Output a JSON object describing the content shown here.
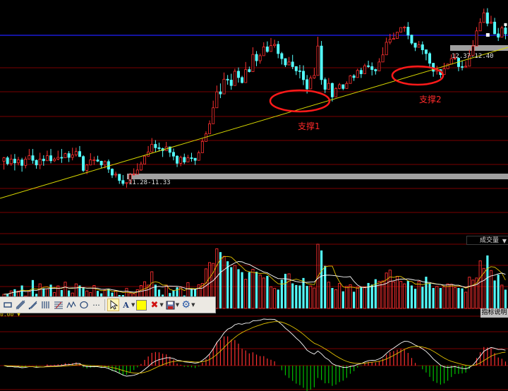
{
  "chart_data": {
    "type": "candlestick",
    "candles": [
      [
        44.0,
        44.8,
        42.0,
        45.0
      ],
      [
        44.8,
        43.4,
        43.0,
        45.2
      ],
      [
        43.4,
        44.5,
        42.9,
        45.6
      ],
      [
        44.5,
        43.6,
        41.8,
        45.7
      ],
      [
        43.6,
        44.3,
        43.0,
        45.0
      ],
      [
        44.3,
        43.0,
        41.5,
        44.8
      ],
      [
        43.0,
        44.5,
        42.3,
        45.1
      ],
      [
        44.5,
        45.3,
        44.7,
        46.9
      ],
      [
        45.3,
        44.2,
        43.4,
        46.9
      ],
      [
        44.2,
        43.1,
        42.2,
        44.4
      ],
      [
        43.1,
        44.5,
        42.1,
        46.0
      ],
      [
        44.5,
        44.1,
        42.9,
        45.4
      ],
      [
        44.1,
        45.3,
        44.3,
        46.5
      ],
      [
        45.3,
        44.1,
        43.5,
        46.9
      ],
      [
        44.1,
        44.5,
        43.8,
        44.9
      ],
      [
        44.5,
        44.9,
        44.2,
        46.5
      ],
      [
        44.9,
        44.8,
        43.6,
        46.9
      ],
      [
        44.8,
        45.8,
        45.4,
        46.0
      ],
      [
        45.8,
        44.9,
        43.8,
        46.4
      ],
      [
        44.9,
        45.5,
        44.2,
        47.2
      ],
      [
        45.5,
        46.3,
        45.1,
        47.2
      ],
      [
        46.3,
        45.1,
        45.0,
        47.6
      ],
      [
        45.1,
        41.8,
        41.4,
        45.4
      ],
      [
        41.8,
        43.1,
        40.9,
        43.3
      ],
      [
        43.1,
        44.3,
        43.0,
        45.9
      ],
      [
        44.3,
        44.3,
        43.1,
        45.1
      ],
      [
        44.3,
        44.0,
        43.8,
        45.3
      ],
      [
        44.0,
        43.1,
        42.4,
        44.1
      ],
      [
        43.1,
        43.9,
        42.3,
        44.2
      ],
      [
        43.9,
        42.1,
        41.2,
        44.4
      ],
      [
        42.1,
        40.7,
        40.0,
        42.3
      ],
      [
        40.7,
        40.9,
        40.1,
        41.5
      ],
      [
        40.9,
        39.4,
        38.6,
        40.9
      ],
      [
        39.4,
        38.7,
        38.2,
        40.7
      ],
      [
        38.7,
        38.9,
        37.7,
        38.9
      ],
      [
        38.9,
        40.8,
        39.6,
        41.2
      ],
      [
        40.8,
        40.9,
        40.6,
        42.3
      ],
      [
        40.9,
        41.9,
        41.1,
        43.5
      ],
      [
        41.9,
        43.3,
        41.7,
        43.9
      ],
      [
        43.3,
        45.2,
        44.9,
        45.5
      ],
      [
        45.2,
        46.2,
        45.1,
        47.6
      ],
      [
        46.2,
        48.0,
        46.7,
        49.5
      ],
      [
        48.0,
        47.2,
        46.1,
        49.0
      ],
      [
        47.2,
        47.0,
        46.3,
        48.4
      ],
      [
        47.0,
        46.5,
        45.0,
        47.2
      ],
      [
        46.5,
        47.4,
        46.9,
        48.6
      ],
      [
        47.4,
        46.1,
        45.0,
        47.4
      ],
      [
        46.1,
        45.2,
        44.2,
        47.0
      ],
      [
        45.2,
        43.5,
        42.6,
        45.4
      ],
      [
        43.5,
        44.9,
        42.8,
        45.3
      ],
      [
        44.9,
        43.8,
        43.3,
        45.8
      ],
      [
        43.8,
        44.8,
        44.6,
        45.5
      ],
      [
        44.8,
        44.7,
        43.9,
        46.0
      ],
      [
        44.7,
        44.2,
        43.1,
        44.7
      ],
      [
        44.2,
        46.0,
        45.7,
        46.5
      ],
      [
        46.0,
        48.7,
        47.6,
        49.4
      ],
      [
        48.7,
        50.5,
        50.1,
        51.1
      ],
      [
        50.5,
        52.9,
        51.8,
        53.7
      ],
      [
        52.9,
        56.7,
        55.3,
        58.4
      ],
      [
        56.7,
        60.5,
        59.7,
        62.0
      ],
      [
        60.5,
        60.0,
        59.0,
        62.5
      ],
      [
        60.0,
        63.5,
        62.6,
        65.1
      ],
      [
        63.5,
        63.3,
        62.2,
        64.5
      ],
      [
        63.3,
        62.0,
        61.0,
        64.8
      ],
      [
        62.0,
        65.4,
        64.9,
        66.0
      ],
      [
        65.4,
        63.9,
        62.7,
        66.3
      ],
      [
        63.9,
        62.7,
        62.5,
        64.3
      ],
      [
        62.7,
        65.8,
        64.3,
        67.6
      ],
      [
        65.8,
        65.3,
        65.1,
        66.5
      ],
      [
        65.3,
        69.4,
        67.8,
        71.1
      ],
      [
        69.4,
        67.9,
        66.6,
        70.2
      ],
      [
        67.9,
        69.1,
        67.2,
        69.6
      ],
      [
        69.1,
        71.2,
        70.9,
        72.3
      ],
      [
        71.2,
        70.1,
        69.8,
        72.5
      ],
      [
        70.1,
        71.5,
        71.1,
        73.3
      ],
      [
        71.5,
        71.8,
        71.0,
        72.9
      ],
      [
        71.8,
        69.6,
        68.5,
        72.6
      ],
      [
        69.6,
        68.4,
        67.0,
        70.0
      ],
      [
        68.4,
        66.9,
        66.4,
        68.5
      ],
      [
        66.9,
        67.6,
        67.4,
        68.8
      ],
      [
        67.6,
        66.5,
        65.9,
        69.3
      ],
      [
        66.5,
        65.5,
        64.5,
        66.6
      ],
      [
        65.5,
        65.4,
        63.7,
        66.9
      ],
      [
        65.4,
        63.4,
        62.1,
        66.8
      ],
      [
        63.4,
        61.2,
        60.1,
        64.5
      ],
      [
        61.2,
        63.8,
        63.4,
        64.4
      ],
      [
        63.8,
        64.4,
        63.6,
        66.2
      ],
      [
        64.4,
        71.4,
        69.8,
        73.6
      ],
      [
        71.4,
        63.4,
        62.2,
        72.6
      ],
      [
        63.4,
        61.1,
        60.2,
        63.9
      ],
      [
        61.1,
        62.5,
        61.2,
        63.8
      ],
      [
        62.5,
        59.3,
        58.2,
        62.7
      ],
      [
        59.3,
        61.3,
        59.6,
        61.6
      ],
      [
        61.3,
        62.2,
        61.1,
        62.6
      ],
      [
        62.2,
        61.3,
        60.9,
        62.2
      ],
      [
        61.3,
        62.5,
        61.4,
        63.0
      ],
      [
        62.5,
        64.3,
        64.0,
        64.5
      ],
      [
        64.3,
        63.9,
        63.1,
        64.7
      ],
      [
        63.9,
        65.6,
        64.8,
        66.0
      ],
      [
        65.6,
        64.8,
        63.8,
        66.2
      ],
      [
        64.8,
        66.7,
        66.4,
        67.2
      ],
      [
        66.7,
        66.5,
        66.2,
        67.9
      ],
      [
        66.5,
        65.8,
        64.4,
        67.5
      ],
      [
        65.8,
        65.5,
        64.6,
        66.0
      ],
      [
        65.5,
        67.6,
        67.2,
        68.5
      ],
      [
        67.6,
        69.3,
        68.4,
        71.1
      ],
      [
        69.3,
        72.3,
        70.8,
        73.4
      ],
      [
        72.3,
        73.0,
        71.8,
        74.3
      ],
      [
        73.0,
        73.2,
        73.3,
        74.6
      ],
      [
        73.2,
        74.7,
        73.6,
        74.6
      ],
      [
        74.7,
        75.8,
        75.1,
        75.7
      ],
      [
        75.8,
        75.9,
        74.8,
        76.2
      ],
      [
        75.9,
        74.0,
        73.0,
        77.1
      ],
      [
        74.0,
        72.1,
        71.7,
        74.1
      ],
      [
        72.1,
        71.1,
        70.2,
        71.3
      ],
      [
        71.1,
        71.7,
        71.2,
        72.6
      ],
      [
        71.7,
        70.5,
        69.4,
        72.5
      ],
      [
        70.5,
        69.6,
        68.0,
        70.5
      ],
      [
        69.6,
        67.3,
        66.1,
        70.0
      ],
      [
        67.3,
        65.4,
        64.1,
        67.4
      ],
      [
        65.4,
        65.8,
        64.6,
        66.7
      ],
      [
        65.8,
        64.6,
        63.8,
        65.9
      ],
      [
        64.6,
        66.0,
        65.3,
        67.4
      ],
      [
        66.0,
        67.1,
        66.3,
        67.2
      ],
      [
        67.1,
        68.4,
        67.0,
        69.4
      ],
      [
        68.4,
        68.5,
        68.1,
        69.6
      ],
      [
        68.5,
        66.5,
        65.4,
        68.7
      ],
      [
        66.5,
        66.4,
        65.6,
        68.0
      ],
      [
        66.4,
        66.6,
        66.4,
        67.8
      ],
      [
        66.6,
        69.2,
        68.5,
        70.5
      ],
      [
        69.2,
        71.4,
        69.9,
        72.8
      ],
      [
        71.4,
        75.0,
        74.9,
        75.9
      ],
      [
        75.0,
        77.0,
        75.2,
        78.0
      ],
      [
        77.0,
        79.3,
        78.1,
        80.3
      ],
      [
        79.3,
        76.8,
        76.1,
        80.4
      ],
      [
        76.8,
        77.1,
        76.7,
        78.6
      ],
      [
        77.1,
        74.3,
        74.2,
        78.1
      ],
      [
        74.3,
        73.5,
        72.6,
        75.7
      ],
      [
        73.5,
        75.7,
        75.3,
        76.2
      ],
      [
        75.7,
        74.3,
        73.0,
        76.5
      ]
    ],
    "value_axis": "unlabeled price scale",
    "volume": [
      [
        3.4,
        0.11
      ],
      [
        3.5,
        0.42
      ],
      [
        4.2,
        0.83
      ],
      [
        4.6,
        0.92
      ],
      [
        4.2,
        0.72
      ],
      [
        5.5,
        0.44
      ],
      [
        3.0,
        0.62
      ],
      [
        4.3,
        0.95
      ],
      [
        6.8,
        0.42
      ],
      [
        3.5,
        0.21
      ],
      [
        5.9,
        0.32
      ],
      [
        4.8,
        0.64
      ],
      [
        4.7,
        0.53
      ],
      [
        5.7,
        0.63
      ],
      [
        3.8,
        0.97
      ],
      [
        5.4,
        0.42
      ],
      [
        4.4,
        0.58
      ],
      [
        6.3,
        0.16
      ],
      [
        4.3,
        0.92
      ],
      [
        3.7,
        0.36
      ],
      [
        5.9,
        0.32
      ],
      [
        5.5,
        0.43
      ],
      [
        5.1,
        0.9
      ],
      [
        4.2,
        0.15
      ],
      [
        3.8,
        0.96
      ],
      [
        5.5,
        0.22
      ],
      [
        4.2,
        0.49
      ],
      [
        3.6,
        0.16
      ],
      [
        4.4,
        0.29
      ],
      [
        4.6,
        0.33
      ],
      [
        3.8,
        0.47
      ],
      [
        4.3,
        0.12
      ],
      [
        3.2,
        0.51
      ],
      [
        3.2,
        0.19
      ],
      [
        4.8,
        0.27
      ],
      [
        3.6,
        0.14
      ],
      [
        3.5,
        0.59
      ],
      [
        4.5,
        0.7
      ],
      [
        5.5,
        0.63
      ],
      [
        6.4,
        0.49
      ],
      [
        5.6,
        0.1
      ],
      [
        8.8,
        0.32
      ],
      [
        5.7,
        0.91
      ],
      [
        4.5,
        0.26
      ],
      [
        3.3,
        0.66
      ],
      [
        5.6,
        0.7
      ],
      [
        3.7,
        0.7
      ],
      [
        4.4,
        0.8
      ],
      [
        5.1,
        0.96
      ],
      [
        5.1,
        0.19
      ],
      [
        3.1,
        0.22
      ],
      [
        6.2,
        0.84
      ],
      [
        4.7,
        0.53
      ],
      [
        4.6,
        0.14
      ],
      [
        5.7,
        0.77
      ],
      [
        6.0,
        0.16
      ],
      [
        9.5,
        0.45
      ],
      [
        11.0,
        0.6
      ],
      [
        10.8,
        0.26
      ],
      [
        14.3,
        0.65
      ],
      [
        13.5,
        0.84
      ],
      [
        12.5,
        0.21
      ],
      [
        11.3,
        0.85
      ],
      [
        9.9,
        0.56
      ],
      [
        10.3,
        0.36
      ],
      [
        9.4,
        0.15
      ],
      [
        8.7,
        0.48
      ],
      [
        7.0,
        0.98
      ],
      [
        8.7,
        0.75
      ],
      [
        9.4,
        0.35
      ],
      [
        8.8,
        0.52
      ],
      [
        8.0,
        0.79
      ],
      [
        7.3,
        0.78
      ],
      [
        7.8,
        0.91
      ],
      [
        5.2,
        0.83
      ],
      [
        4.8,
        0.92
      ],
      [
        4.5,
        0.24
      ],
      [
        6.9,
        0.53
      ],
      [
        8.3,
        0.85
      ],
      [
        8.3,
        0.47
      ],
      [
        6.0,
        0.82
      ],
      [
        5.6,
        0.35
      ],
      [
        5.5,
        0.84
      ],
      [
        7.3,
        0.18
      ],
      [
        5.4,
        0.35
      ],
      [
        5.4,
        0.4
      ],
      [
        4.9,
        0.24
      ],
      [
        15.4,
        0.48
      ],
      [
        13.9,
        0.93
      ],
      [
        10.2,
        0.27
      ],
      [
        6.3,
        0.59
      ],
      [
        4.9,
        0.88
      ],
      [
        4.5,
        0.19
      ],
      [
        6.0,
        0.44
      ],
      [
        4.1,
        0.3
      ],
      [
        5.3,
        0.33
      ],
      [
        5.7,
        0.8
      ],
      [
        4.0,
        0.65
      ],
      [
        5.1,
        0.47
      ],
      [
        5.2,
        0.29
      ],
      [
        5.2,
        0.12
      ],
      [
        6.1,
        0.4
      ],
      [
        5.7,
        0.16
      ],
      [
        7.0,
        0.32
      ],
      [
        6.5,
        0.61
      ],
      [
        6.6,
        0.81
      ],
      [
        8.5,
        0.63
      ],
      [
        9.2,
        0.73
      ],
      [
        6.4,
        0.48
      ],
      [
        7.7,
        0.74
      ],
      [
        6.5,
        0.97
      ],
      [
        5.9,
        0.25
      ],
      [
        6.6,
        0.75
      ],
      [
        5.5,
        0.15
      ],
      [
        4.7,
        0.52
      ],
      [
        6.5,
        0.98
      ],
      [
        5.2,
        0.17
      ],
      [
        7.6,
        0.19
      ],
      [
        6.1,
        0.19
      ],
      [
        4.9,
        0.78
      ],
      [
        5.3,
        0.94
      ],
      [
        4.9,
        0.39
      ],
      [
        5.2,
        0.68
      ],
      [
        5.9,
        0.69
      ],
      [
        5.8,
        0.89
      ],
      [
        5.0,
        0.62
      ],
      [
        4.9,
        0.39
      ],
      [
        4.8,
        0.97
      ],
      [
        3.9,
        0.22
      ],
      [
        7.5,
        0.28
      ],
      [
        6.8,
        0.61
      ],
      [
        7.3,
        0.5
      ],
      [
        11.4,
        0.19
      ],
      [
        9.6,
        0.16
      ],
      [
        12.7,
        0.72
      ],
      [
        9.1,
        0.22
      ],
      [
        6.7,
        0.15
      ],
      [
        8.1,
        0.14
      ],
      [
        5.6,
        0.26
      ],
      [
        4.5,
        0.41
      ]
    ],
    "volume_panel_label": "成交量",
    "indicator_panel_label": "指标说明",
    "indicator_value_label": "0.00 ▼",
    "support_levels": [
      {
        "label": "11.28-11.33"
      },
      {
        "label": "12.37-12.40"
      }
    ],
    "annotations": [
      "支撑1",
      "支撑2"
    ],
    "top_label": "",
    "colors": {
      "up": "#ff3030",
      "down": "#54ffff",
      "trendline": "#d8d800",
      "ma1": "#ffffff",
      "ma2": "#e0c000",
      "hline": "#2020ff",
      "level_bar": "#a0a0a0",
      "grid": "#7a0000",
      "macd_pos": "#ff3030",
      "macd_neg": "#00c000"
    }
  },
  "toolbar": {
    "tools": [
      "rectangle-tool",
      "ruler-tool",
      "pen-tool",
      "parallel-lines-tool",
      "gann-tool",
      "wave-tool",
      "ellipse-tool",
      "more-tool",
      "pointer-tool",
      "text-tool",
      "color-swatch",
      "delete-tool",
      "save-tool",
      "settings-tool"
    ],
    "text_tool_label": "A",
    "more_label": "···"
  }
}
